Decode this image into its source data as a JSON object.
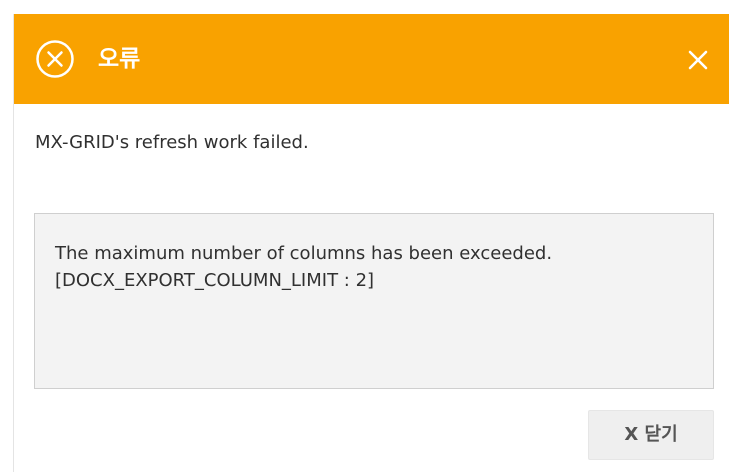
{
  "dialog": {
    "title": "오류",
    "icons": {
      "header": "error-circle-x-icon",
      "close": "close-icon"
    },
    "colors": {
      "header_background": "#f9a200",
      "header_text": "#ffffff"
    },
    "message": "MX-GRID's refresh work failed.",
    "detail": {
      "line1": "The maximum number of columns has been exceeded.",
      "line2": "[DOCX_EXPORT_COLUMN_LIMIT : 2]"
    },
    "buttons": {
      "close_label": "X 닫기"
    }
  }
}
